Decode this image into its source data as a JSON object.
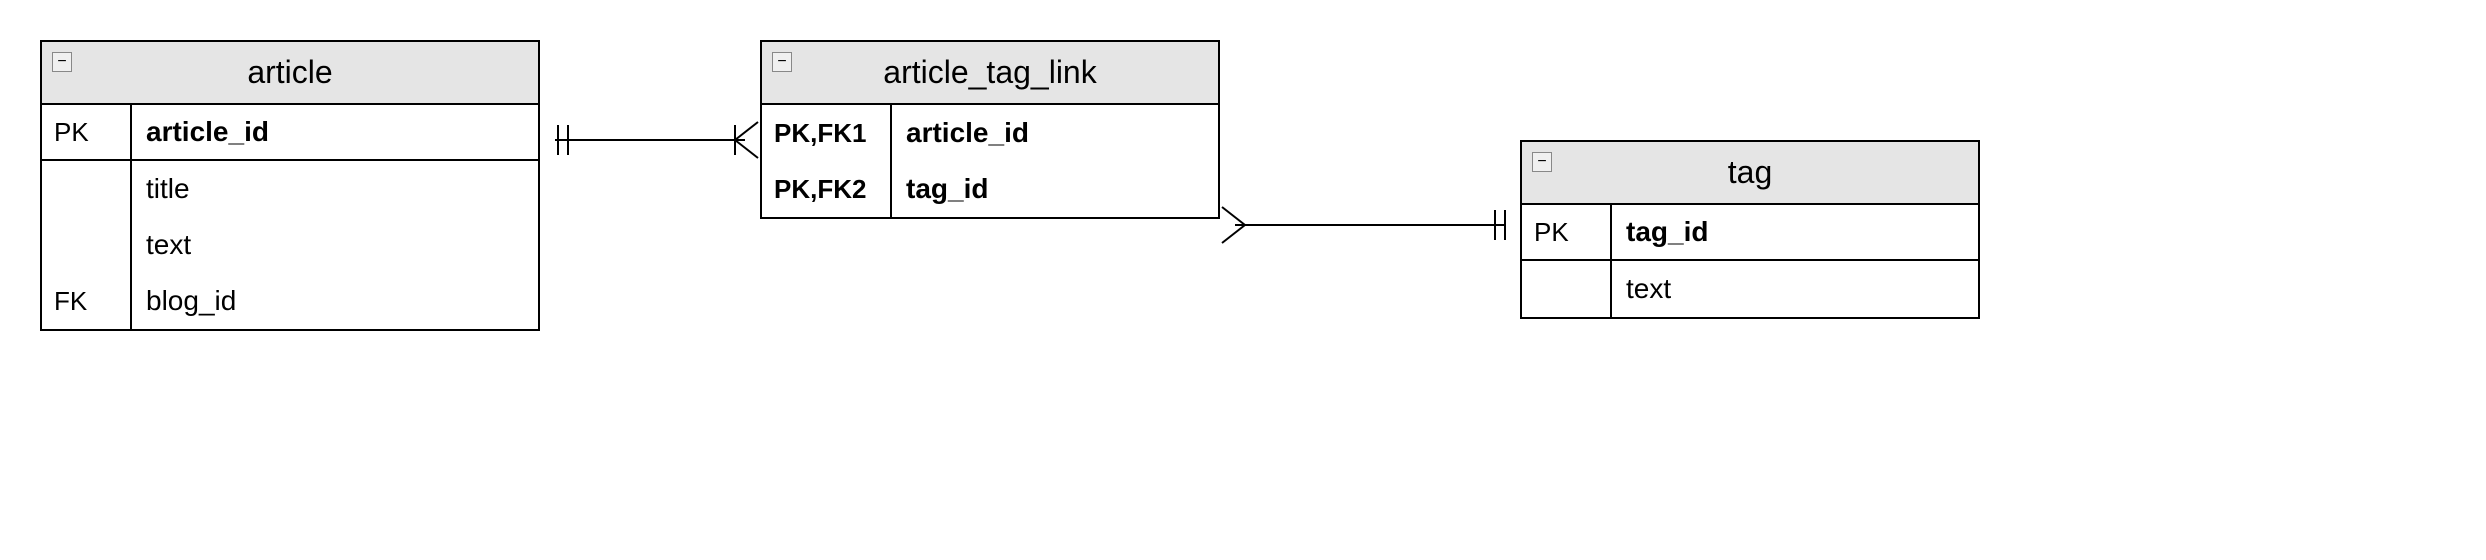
{
  "entities": {
    "article": {
      "title": "article",
      "rows": [
        {
          "key": "PK",
          "name": "article_id",
          "bold": true,
          "pk": true
        },
        {
          "key": "",
          "name": "title",
          "bold": false,
          "pk": false
        },
        {
          "key": "",
          "name": "text",
          "bold": false,
          "pk": false
        },
        {
          "key": "FK",
          "name": "blog_id",
          "bold": false,
          "pk": false
        }
      ]
    },
    "article_tag_link": {
      "title": "article_tag_link",
      "rows": [
        {
          "key": "PK,FK1",
          "name": "article_id",
          "bold": true,
          "pk": true
        },
        {
          "key": "PK,FK2",
          "name": "tag_id",
          "bold": true,
          "pk": true
        }
      ]
    },
    "tag": {
      "title": "tag",
      "rows": [
        {
          "key": "PK",
          "name": "tag_id",
          "bold": true,
          "pk": true
        },
        {
          "key": "",
          "name": "text",
          "bold": false,
          "pk": false
        }
      ]
    }
  },
  "collapse_glyph": "−",
  "relations": [
    {
      "from": "article",
      "to": "article_tag_link",
      "from_card": "one",
      "to_card": "many"
    },
    {
      "from": "tag",
      "to": "article_tag_link",
      "from_card": "one",
      "to_card": "many"
    }
  ]
}
